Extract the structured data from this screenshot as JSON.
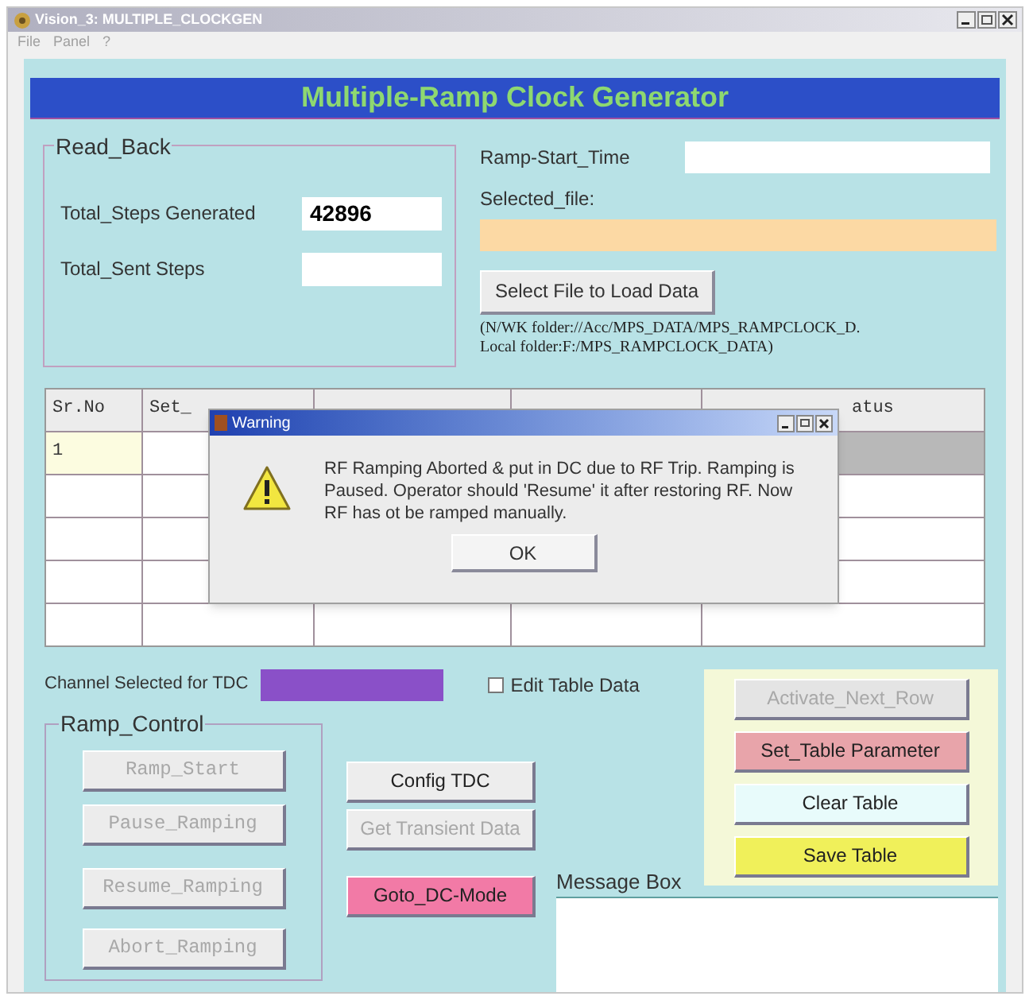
{
  "window": {
    "title": "Vision_3: MULTIPLE_CLOCKGEN"
  },
  "menu": [
    "File",
    "Panel",
    "?"
  ],
  "header": "Multiple-Ramp Clock Generator",
  "read_back": {
    "title": "Read_Back",
    "fields": [
      {
        "label": "Total_Steps Generated",
        "value": "42896"
      },
      {
        "label": "Total_Sent Steps"
      }
    ]
  },
  "ramp_start_time": {
    "label": "Ramp-Start_Time"
  },
  "selected_file": {
    "label": "Selected_file:"
  },
  "load_button": {
    "label": "Select File to Load Data"
  },
  "path_note": [
    "(N/WK folder://Acc/MPS_DATA/MPS_RAMPCLOCK_D.",
    "Local folder:F:/MPS_RAMPCLOCK_DATA)"
  ],
  "table": {
    "columns": [
      {
        "label": "Sr.No"
      },
      {
        "label": "Set_"
      },
      {},
      {},
      {
        "label": "atus"
      }
    ],
    "rows": [
      {
        "number": "1",
        "selected": true
      },
      {
        "selected": false
      },
      {
        "selected": false
      },
      {
        "selected": false
      },
      {
        "selected": false
      }
    ]
  },
  "dialog": {
    "title": "Warning",
    "message": "RF Ramping Aborted & put in DC due to RF Trip. Ramping is Paused. Operator should 'Resume' it after restoring RF. Now RF has ot be ramped manually.",
    "button": "OK"
  },
  "tdc_channel": {
    "label": "Channel Selected for TDC"
  },
  "edit_table": {
    "label": "Edit Table Data",
    "checked": false
  },
  "ramp_control": {
    "title": "Ramp_Control",
    "buttons": [
      {
        "label": "Ramp_Start",
        "disabled": true
      },
      {
        "label": "Pause_Ramping",
        "disabled": true
      },
      {
        "label": "Resume_Ramping",
        "disabled": true
      },
      {
        "label": "Abort_Ramping",
        "disabled": true
      }
    ]
  },
  "middle_buttons": [
    {
      "label": "Config TDC",
      "disabled": false,
      "color": "#ededed"
    },
    {
      "label": "Get Transient Data",
      "disabled": true,
      "color": "#ededed"
    },
    {
      "label": "Goto_DC-Mode",
      "disabled": false,
      "color": "#f27aa6"
    }
  ],
  "table_buttons": [
    {
      "label": "Activate_Next_Row",
      "disabled": true,
      "color": "#e4e4e4"
    },
    {
      "label": "Set_Table Parameter",
      "disabled": false,
      "color": "#e8a4aa"
    },
    {
      "label": "Clear Table",
      "disabled": false,
      "color": "#e8fbfb"
    },
    {
      "label": "Save Table",
      "disabled": false,
      "color": "#f0f05a"
    }
  ],
  "message_box": {
    "label": "Message Box"
  }
}
